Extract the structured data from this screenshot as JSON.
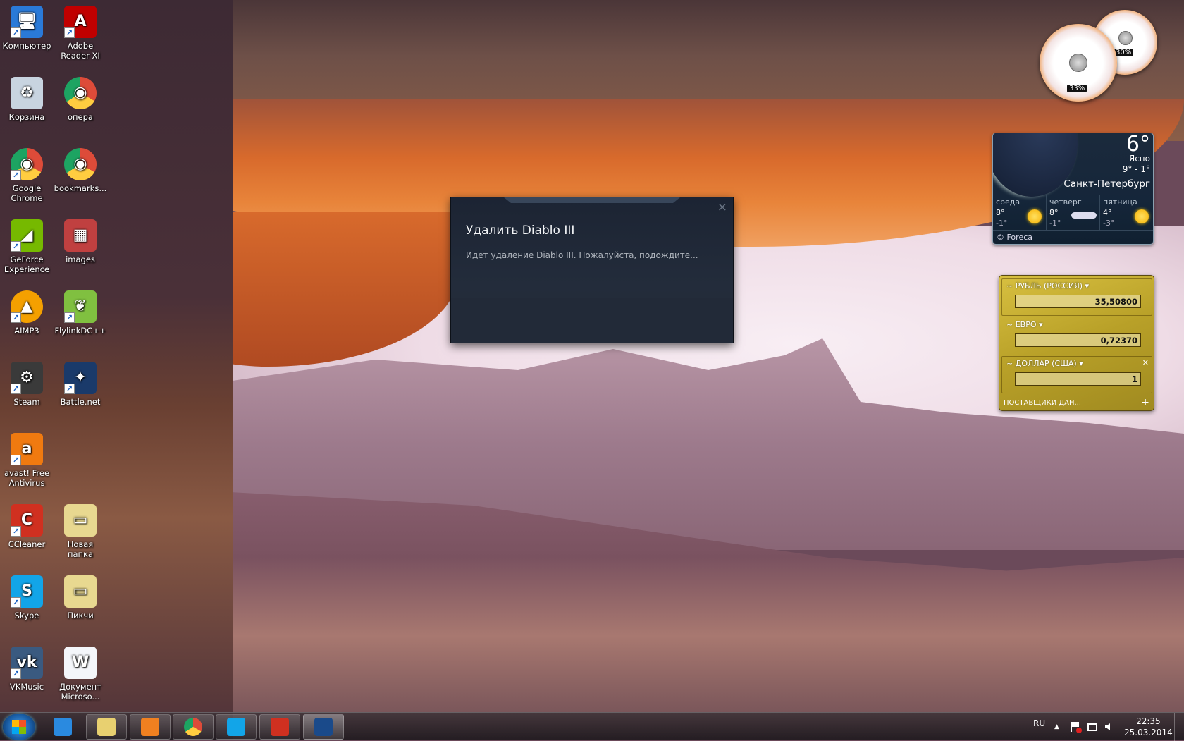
{
  "desktop_icons": [
    {
      "label": "Компьютер",
      "icon": "computer-icon",
      "color": "#2a7ad8",
      "shortcut": true
    },
    {
      "label": "Adobe Reader XI",
      "icon": "adobe-reader-icon",
      "color": "#c00000",
      "shortcut": true
    },
    {
      "label": "Корзина",
      "icon": "recycle-bin-icon",
      "color": "#c8d4e0",
      "shortcut": false
    },
    {
      "label": "опера",
      "icon": "chrome-icon",
      "color": "#dd4b39",
      "shortcut": false
    },
    {
      "label": "Google Chrome",
      "icon": "chrome-icon",
      "color": "#dd4b39",
      "shortcut": true
    },
    {
      "label": "bookmarks...",
      "icon": "chrome-icon",
      "color": "#dd4b39",
      "shortcut": false
    },
    {
      "label": "GeForce Experience",
      "icon": "geforce-icon",
      "color": "#76b900",
      "shortcut": true
    },
    {
      "label": "images",
      "icon": "image-icon",
      "color": "#c04040",
      "shortcut": false
    },
    {
      "label": "AIMP3",
      "icon": "aimp-icon",
      "color": "#f4a000",
      "shortcut": true
    },
    {
      "label": "FlylinkDC++",
      "icon": "butterfly-icon",
      "color": "#80c040",
      "shortcut": true
    },
    {
      "label": "Steam",
      "icon": "steam-icon",
      "color": "#3a3a3a",
      "shortcut": true
    },
    {
      "label": "Battle.net",
      "icon": "battlenet-icon",
      "color": "#1a3a6a",
      "shortcut": true
    },
    {
      "label": "avast! Free Antivirus",
      "icon": "avast-icon",
      "color": "#f07a10",
      "shortcut": true
    },
    {
      "label": "",
      "icon": "",
      "color": "",
      "shortcut": false
    },
    {
      "label": "CCleaner",
      "icon": "ccleaner-icon",
      "color": "#d03020",
      "shortcut": true
    },
    {
      "label": "Новая папка",
      "icon": "folder-icon",
      "color": "#e8d890",
      "shortcut": false
    },
    {
      "label": "Skype",
      "icon": "skype-icon",
      "color": "#12a5e8",
      "shortcut": true
    },
    {
      "label": "Пикчи",
      "icon": "folder-icon",
      "color": "#e8d890",
      "shortcut": false
    },
    {
      "label": "VKMusic",
      "icon": "vkmusic-icon",
      "color": "#3a5a80",
      "shortcut": true
    },
    {
      "label": "Документ Microso...",
      "icon": "word-document-icon",
      "color": "#f4f6fa",
      "shortcut": false
    }
  ],
  "icon_glyphs": {
    "Компьютер": "🖥",
    "Adobe Reader XI": "A",
    "Корзина": "♻",
    "опера": "◉",
    "Google Chrome": "◉",
    "bookmarks...": "◉",
    "GeForce Experience": "◢",
    "images": "▦",
    "AIMP3": "▲",
    "FlylinkDC++": "❦",
    "Steam": "⚙",
    "Battle.net": "✦",
    "avast! Free Antivirus": "a",
    "CCleaner": "C",
    "Новая папка": "▭",
    "Skype": "S",
    "Пикчи": "▭",
    "VKMusic": "vk",
    "Документ Microso...": "W"
  },
  "dialog": {
    "title": "Удалить Diablo III",
    "message": "Идет удаление Diablo III. Пожалуйста, подождите...",
    "close": "×"
  },
  "cpu_gadget": {
    "cpu_percent": "33%",
    "memory_percent": "30%",
    "cpu_value": 33,
    "memory_value": 30
  },
  "weather": {
    "temperature": "6°",
    "condition": "Ясно",
    "range": "9° - 1°",
    "city": "Санкт-Петербург",
    "forecast": [
      {
        "day": "среда",
        "high": "8°",
        "low": "-1°",
        "icon": "sun-icon"
      },
      {
        "day": "четверг",
        "high": "8°",
        "low": "-1°",
        "icon": "cloud-icon"
      },
      {
        "day": "пятница",
        "high": "4°",
        "low": "-3°",
        "icon": "sun-icon"
      }
    ],
    "provider": "© Foreca"
  },
  "currency": {
    "rows": [
      {
        "name": "РУБЛЬ (РОССИЯ) ▾",
        "value": "35,50800"
      },
      {
        "name": "ЕВРО ▾",
        "value": "0,72370"
      },
      {
        "name": "ДОЛЛАР (США) ▾",
        "value": "1"
      }
    ],
    "trend_glyph": "~",
    "close": "✕",
    "providers": "ПОСТАВЩИКИ ДАН...",
    "add": "+"
  },
  "taskbar": {
    "language": "RU",
    "time": "22:35",
    "date": "25.03.2014",
    "tray_up": "▲",
    "apps": [
      {
        "name": "internet-explorer",
        "color": "#2a8ae0",
        "pinned_plain": true
      },
      {
        "name": "windows-explorer",
        "color": "#e8d070"
      },
      {
        "name": "media-player",
        "color": "#f08020"
      },
      {
        "name": "chrome",
        "color": "#dd4b39"
      },
      {
        "name": "skype",
        "color": "#12a5e8"
      },
      {
        "name": "ccleaner",
        "color": "#d03020"
      },
      {
        "name": "battlenet",
        "color": "#1a4a8a",
        "active": true
      }
    ]
  }
}
